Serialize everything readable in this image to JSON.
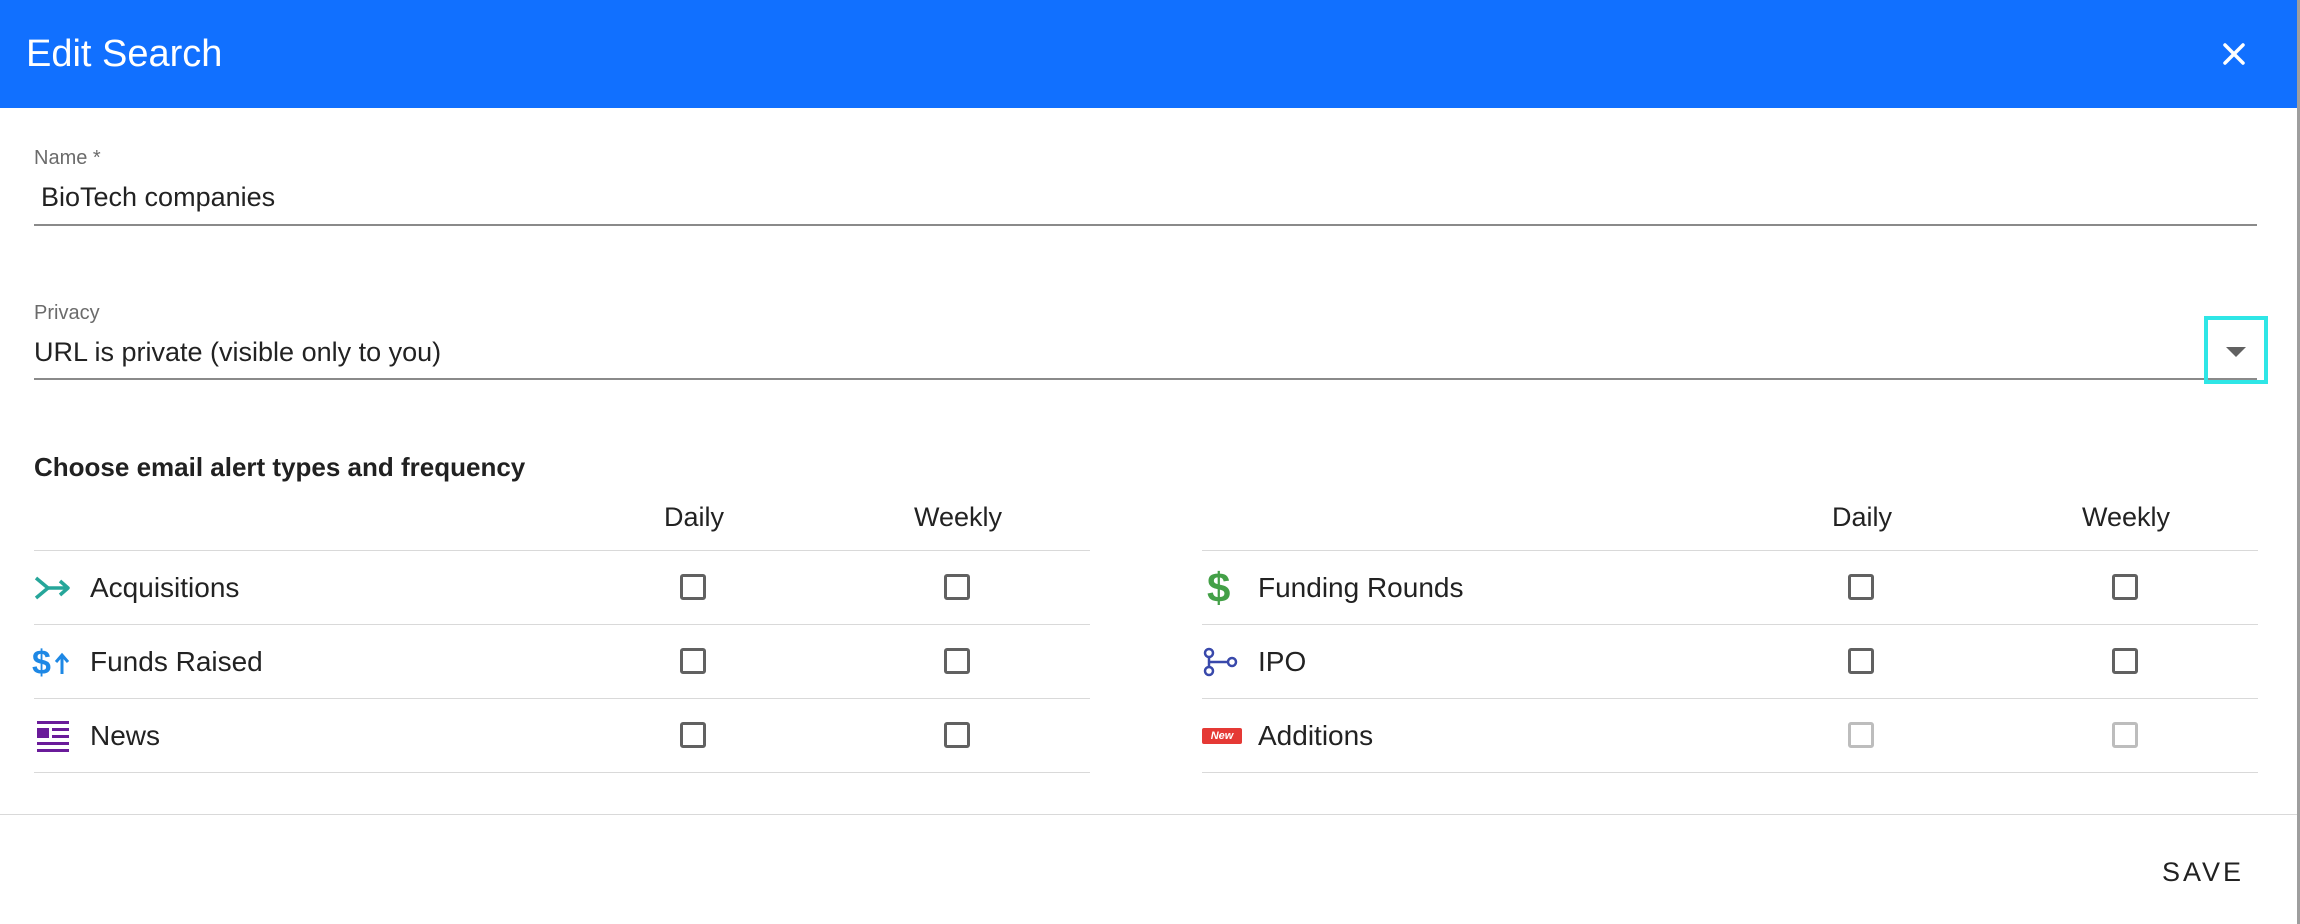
{
  "dialog": {
    "title": "Edit Search"
  },
  "name_field": {
    "label": "Name *",
    "value": "BioTech companies"
  },
  "privacy_field": {
    "label": "Privacy",
    "value": "URL is private (visible only to you)"
  },
  "alerts": {
    "section_title": "Choose email alert types and frequency",
    "columns": {
      "daily": "Daily",
      "weekly": "Weekly"
    },
    "left_rows": [
      {
        "label": "Acquisitions",
        "icon": "acquisitions-icon",
        "daily": false,
        "weekly": false,
        "disabled": false
      },
      {
        "label": "Funds Raised",
        "icon": "funds-raised-icon",
        "daily": false,
        "weekly": false,
        "disabled": false
      },
      {
        "label": "News",
        "icon": "news-icon",
        "daily": false,
        "weekly": false,
        "disabled": false
      }
    ],
    "right_rows": [
      {
        "label": "Funding Rounds",
        "icon": "dollar-icon",
        "daily": false,
        "weekly": false,
        "disabled": false
      },
      {
        "label": "IPO",
        "icon": "ipo-icon",
        "daily": false,
        "weekly": false,
        "disabled": false
      },
      {
        "label": "Additions",
        "icon": "new-badge-icon",
        "badge": "New",
        "daily": false,
        "weekly": false,
        "disabled": true
      }
    ]
  },
  "footer": {
    "save_label": "SAVE"
  },
  "colors": {
    "header_bg": "#1170ff",
    "focus_outline": "#2ee6e6",
    "acquisitions_icon": "#26a69a",
    "funds_raised_icon": "#1e88e5",
    "news_icon": "#6a1b9a",
    "dollar_icon": "#43a047",
    "ipo_icon": "#3949ab",
    "new_badge": "#e53935"
  }
}
